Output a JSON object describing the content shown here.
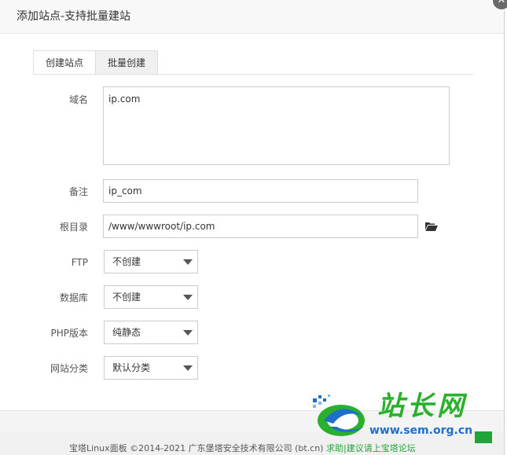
{
  "modal": {
    "title": "添加站点-支持批量建站",
    "close_icon": "close-icon"
  },
  "tabs": [
    {
      "label": "创建站点",
      "active": true
    },
    {
      "label": "批量创建",
      "active": false
    }
  ],
  "form": {
    "domain": {
      "label": "域名",
      "value": "ip.com"
    },
    "remark": {
      "label": "备注",
      "value": "ip_com"
    },
    "root_dir": {
      "label": "根目录",
      "value": "/www/wwwroot/ip.com",
      "icon": "folder-open-icon"
    },
    "ftp": {
      "label": "FTP",
      "value": "不创建"
    },
    "database": {
      "label": "数据库",
      "value": "不创建"
    },
    "php_version": {
      "label": "PHP版本",
      "value": "纯静态"
    },
    "site_category": {
      "label": "网站分类",
      "value": "默认分类"
    }
  },
  "background": {
    "footer_text": "宝塔Linux面板 ©2014-2021 广东堡塔安全技术有限公司 (bt.cn)",
    "footer_link": "求助|建议请上宝塔论坛"
  },
  "watermark": {
    "site_name": "站长网",
    "url": "www.sem.org.cn"
  },
  "colors": {
    "accent_green": "#20a53a",
    "watermark_green": "#2bb02e",
    "watermark_blue": "#1f6fc9"
  }
}
